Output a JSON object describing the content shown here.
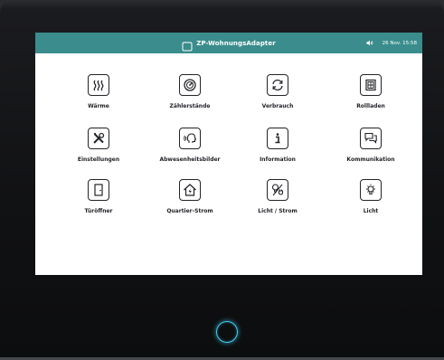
{
  "header": {
    "title": "ZP-WohnungsAdapter",
    "date_time": "26 Nov. 15:58",
    "icons": {
      "title": "tablet-icon",
      "sound": "speaker-icon"
    }
  },
  "tiles": [
    {
      "label": "Wärme",
      "icon": "heat-waves-icon"
    },
    {
      "label": "Zählerstände",
      "icon": "meter-dial-icon"
    },
    {
      "label": "Verbrauch",
      "icon": "cycle-arrows-icon"
    },
    {
      "label": "Rollladen",
      "icon": "window-shutter-icon"
    },
    {
      "label": "Einstellungen",
      "icon": "tools-icon"
    },
    {
      "label": "Abwesenheitsbilder",
      "icon": "voice-head-icon"
    },
    {
      "label": "Information",
      "icon": "info-icon"
    },
    {
      "label": "Kommunikation",
      "icon": "chat-bubbles-icon"
    },
    {
      "label": "Türöffner",
      "icon": "door-icon"
    },
    {
      "label": "Quartier-Strom",
      "icon": "house-power-icon"
    },
    {
      "label": "Licht / Strom",
      "icon": "bulb-plug-icon"
    },
    {
      "label": "Licht",
      "icon": "light-bulb-icon"
    }
  ],
  "colors": {
    "header_bg": "#3a8d8c",
    "home_ring": "#3fd0f2"
  }
}
